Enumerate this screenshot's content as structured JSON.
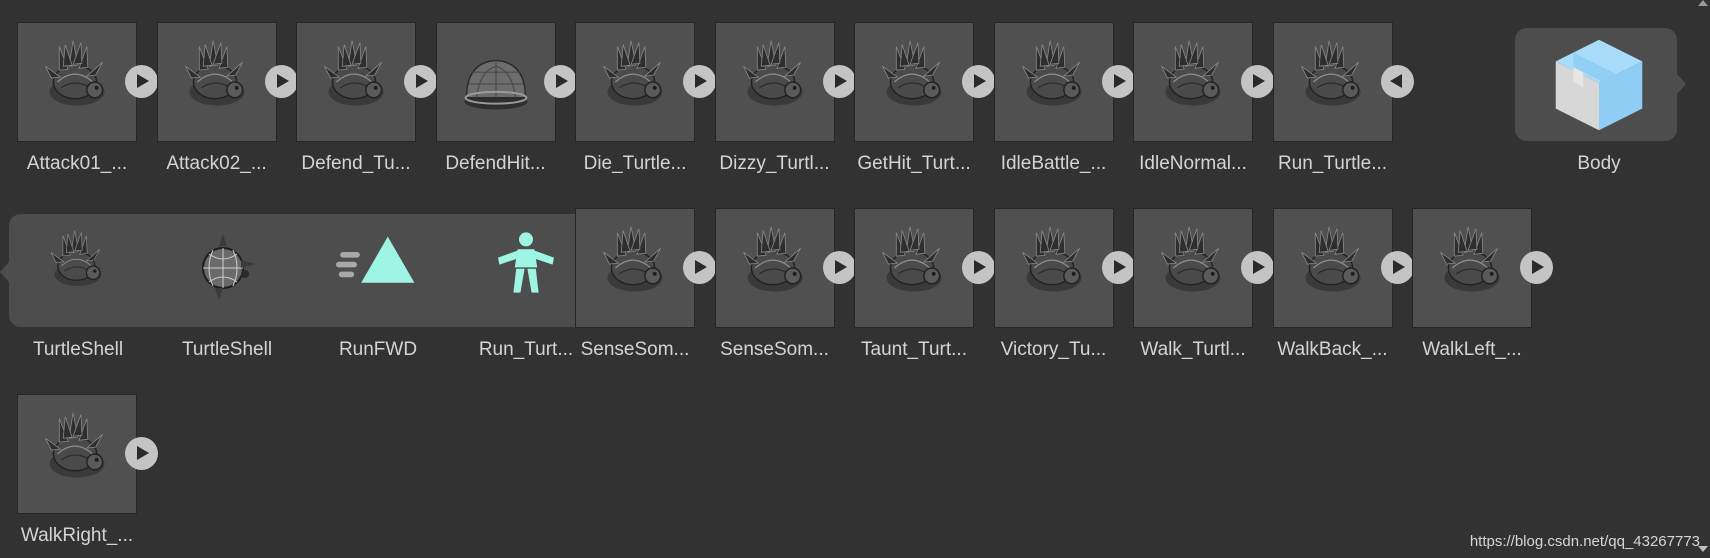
{
  "assets": [
    {
      "label": "Attack01_...",
      "icon": "turtle-shell-icon",
      "button": "expand"
    },
    {
      "label": "Attack02_...",
      "icon": "turtle-shell-icon",
      "button": "expand"
    },
    {
      "label": "Defend_Tu...",
      "icon": "turtle-shell-icon",
      "button": "expand"
    },
    {
      "label": "DefendHit...",
      "icon": "shell-dome-icon",
      "button": "expand"
    },
    {
      "label": "Die_Turtle...",
      "icon": "turtle-shell-icon",
      "button": "expand"
    },
    {
      "label": "Dizzy_Turtl...",
      "icon": "turtle-shell-icon",
      "button": "expand"
    },
    {
      "label": "GetHit_Turt...",
      "icon": "turtle-shell-icon",
      "button": "expand"
    },
    {
      "label": "IdleBattle_...",
      "icon": "turtle-shell-icon",
      "button": "expand"
    },
    {
      "label": "IdleNormal...",
      "icon": "turtle-shell-icon",
      "button": "expand"
    },
    {
      "label": "Run_Turtle...",
      "icon": "turtle-shell-icon",
      "button": "collapse"
    },
    {
      "label": "Body",
      "icon": "prefab-box-icon",
      "button": "none"
    },
    {
      "label": "TurtleShell",
      "icon": "turtle-shell-icon",
      "button": "none"
    },
    {
      "label": "TurtleShell",
      "icon": "mesh-sphere-icon",
      "button": "none"
    },
    {
      "label": "RunFWD",
      "icon": "animation-clip-icon",
      "button": "none"
    },
    {
      "label": "Run_Turt...",
      "icon": "avatar-icon",
      "button": "none"
    },
    {
      "label": "SenseSom...",
      "icon": "turtle-shell-icon",
      "button": "expand"
    },
    {
      "label": "SenseSom...",
      "icon": "turtle-shell-icon",
      "button": "expand"
    },
    {
      "label": "Taunt_Turt...",
      "icon": "turtle-shell-icon",
      "button": "expand"
    },
    {
      "label": "Victory_Tu...",
      "icon": "turtle-shell-icon",
      "button": "expand"
    },
    {
      "label": "Walk_Turtl...",
      "icon": "turtle-shell-icon",
      "button": "expand"
    },
    {
      "label": "WalkBack_...",
      "icon": "turtle-shell-icon",
      "button": "expand"
    },
    {
      "label": "WalkLeft_...",
      "icon": "turtle-shell-icon",
      "button": "expand"
    },
    {
      "label": "WalkRight_...",
      "icon": "turtle-shell-icon",
      "button": "expand"
    }
  ],
  "watermark": "https://blog.csdn.net/qq_43267773",
  "colors": {
    "background": "#323232",
    "tile": "#505050",
    "panel": "#4d4d4d",
    "accent_teal": "#9ef5e3",
    "accent_blue": "#8fcdf4"
  }
}
